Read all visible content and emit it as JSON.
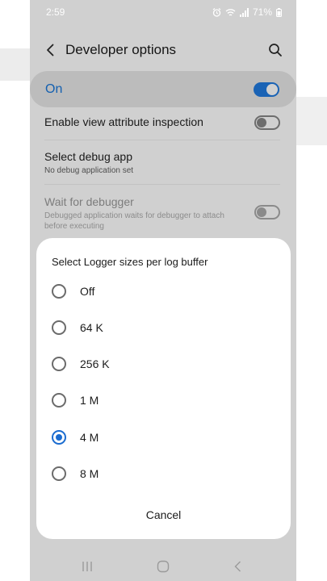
{
  "status_bar": {
    "time": "2:59",
    "battery": "71%",
    "icons": [
      "alarm-icon",
      "wifi-icon",
      "signal-icon",
      "battery-icon"
    ]
  },
  "appbar": {
    "title": "Developer options",
    "back_icon": "back-arrow-icon",
    "search_icon": "search-icon"
  },
  "master_switch": {
    "label": "On",
    "state": true,
    "accent": "#1a63b5"
  },
  "settings": [
    {
      "title": "Enable view attribute inspection",
      "toggle": false
    },
    {
      "title": "Select debug app",
      "subtitle": "No debug application set"
    },
    {
      "title": "Wait for debugger",
      "subtitle_line1": "Debugged application waits for debugger to attach",
      "subtitle_line2": "before executing",
      "toggle": false,
      "disabled": true
    }
  ],
  "dialog": {
    "title": "Select Logger sizes per log buffer",
    "options": [
      {
        "label": "Off",
        "selected": false
      },
      {
        "label": "64 K",
        "selected": false
      },
      {
        "label": "256 K",
        "selected": false
      },
      {
        "label": "1 M",
        "selected": false
      },
      {
        "label": "4 M",
        "selected": true
      },
      {
        "label": "8 M",
        "selected": false
      }
    ],
    "cancel_label": "Cancel",
    "radio_accent": "#1b6cd0"
  },
  "navbar": {
    "icons": [
      "recent-apps-icon",
      "home-icon",
      "back-icon"
    ]
  }
}
